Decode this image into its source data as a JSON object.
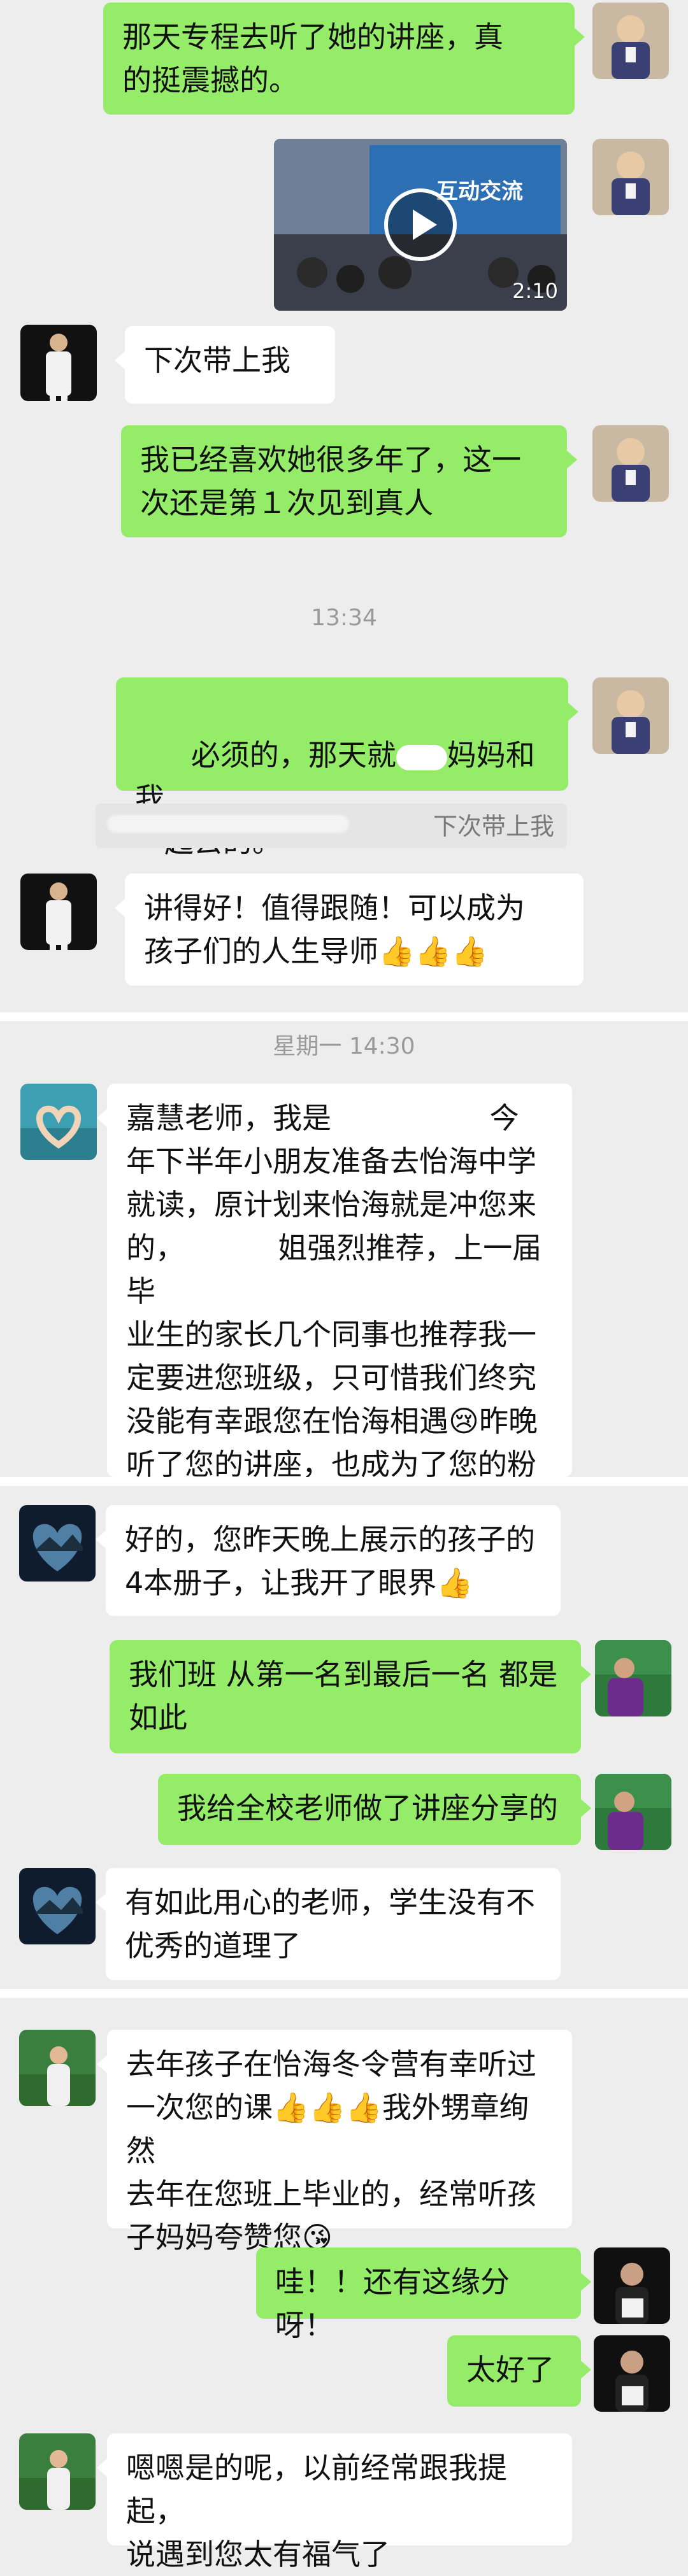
{
  "colors": {
    "sent_bubble": "#95ec69",
    "received_bubble": "#ffffff",
    "background": "#ededed",
    "timestamp": "#9a9a9a"
  },
  "segments": [
    {
      "messages": [
        {
          "id": "m1",
          "side": "right",
          "type": "text",
          "text": "那天专程去听了她的讲座，真\n的挺震撼的。",
          "avatar": "avatar-child-icon"
        },
        {
          "id": "m2",
          "side": "right",
          "type": "video",
          "duration": "2:10",
          "video_text": "互动交流",
          "avatar": "avatar-child-icon"
        },
        {
          "id": "m3",
          "side": "left",
          "type": "text",
          "text": "下次带上我",
          "avatar": "avatar-woman-white-suit-icon"
        },
        {
          "id": "m4",
          "side": "right",
          "type": "text",
          "text": "我已经喜欢她很多年了，这一\n次还是第１次见到真人",
          "avatar": "avatar-child-icon"
        }
      ],
      "time": "13:34",
      "after_time": [
        {
          "id": "m5",
          "side": "right",
          "type": "text",
          "text_before": "必须的，那天就",
          "text_after": "妈妈和我\n一起去的。",
          "avatar": "avatar-child-icon"
        },
        {
          "id": "m5q",
          "type": "quote",
          "text": "下次带上我"
        },
        {
          "id": "m6",
          "side": "left",
          "type": "text",
          "text": "讲得好！值得跟随！可以成为\n孩子们的人生导师👍👍👍",
          "avatar": "avatar-woman-white-suit-icon"
        }
      ]
    },
    {
      "time": "星期一 14:30",
      "messages": [
        {
          "id": "m7",
          "side": "left",
          "type": "text",
          "text": "嘉慧老师，我是                 今\n年下半年小朋友准备去怡海中学\n就读，原计划来怡海就是冲您来\n的，          姐强烈推荐，上一届毕\n业生的家长几个同事也推荐我一\n定要进您班级，只可惜我们终究\n没能有幸跟您在怡海相遇😢昨晚\n听了您的讲座，也成为了您的粉\n丝",
          "avatar": "avatar-heart-hands-icon"
        }
      ]
    },
    {
      "messages": [
        {
          "id": "m8",
          "side": "left",
          "type": "text",
          "text": "好的，您昨天晚上展示的孩子的\n4本册子，让我开了眼界👍",
          "avatar": "avatar-heart-landscape-icon"
        },
        {
          "id": "m9",
          "side": "right",
          "type": "text",
          "text": "我们班 从第一名到最后一名 都是\n如此",
          "avatar": "avatar-teacher-classroom-icon"
        },
        {
          "id": "m10",
          "side": "right",
          "type": "text",
          "text": "我给全校老师做了讲座分享的",
          "avatar": "avatar-teacher-classroom-icon"
        },
        {
          "id": "m11",
          "side": "left",
          "type": "text",
          "text": "有如此用心的老师，学生没有不\n优秀的道理了",
          "avatar": "avatar-heart-landscape-icon"
        }
      ]
    },
    {
      "messages": [
        {
          "id": "m12",
          "side": "left",
          "type": "text",
          "text": "去年孩子在怡海冬令营有幸听过\n一次您的课👍👍👍我外甥章绚然\n去年在您班上毕业的，经常听孩\n子妈妈夸赞您😘",
          "avatar": "avatar-girl-garden-icon"
        },
        {
          "id": "m13",
          "side": "right",
          "type": "text",
          "text": "哇！！还有这缘分呀！",
          "avatar": "avatar-teacher-portrait-icon"
        },
        {
          "id": "m14",
          "side": "right",
          "type": "text",
          "text": "太好了",
          "avatar": "avatar-teacher-portrait-icon"
        },
        {
          "id": "m15",
          "side": "left",
          "type": "text",
          "text": "嗯嗯是的呢，以前经常跟我提起，\n说遇到您太有福气了",
          "avatar": "avatar-girl-garden-icon"
        }
      ]
    }
  ]
}
